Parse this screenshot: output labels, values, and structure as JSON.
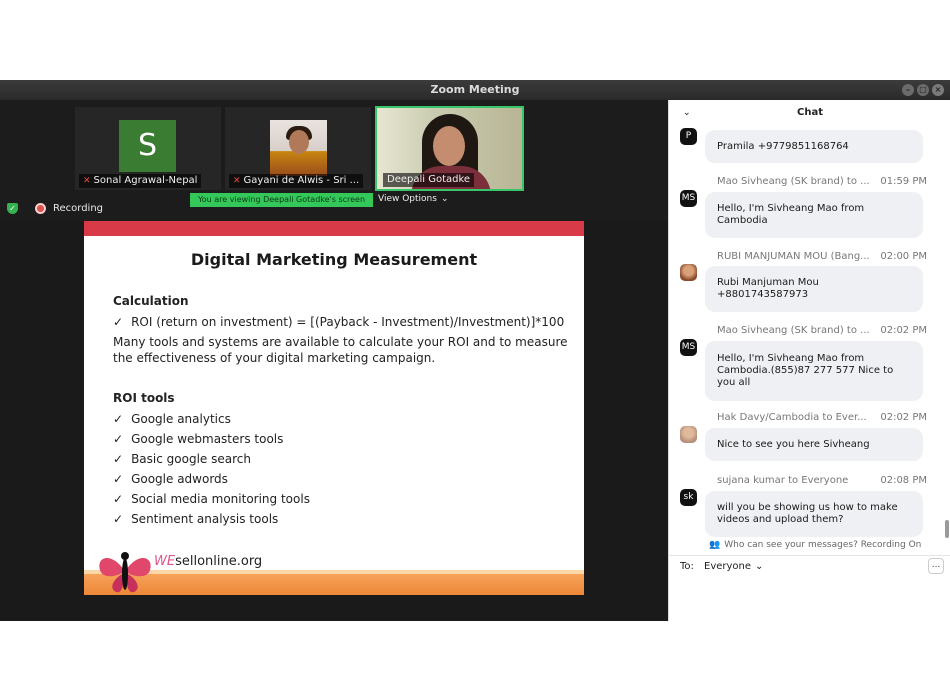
{
  "window": {
    "title": "Zoom Meeting"
  },
  "participants": [
    {
      "name": "Sonal Agrawal-Nepal",
      "initial": "S"
    },
    {
      "name": "Gayani de Alwis  - Sri ..."
    },
    {
      "name": "Deepali Gotadke"
    }
  ],
  "status": {
    "recording_label": "Recording",
    "viewing_banner": "You are viewing Deepali Gotadke's screen",
    "view_options": "View Options"
  },
  "slide": {
    "title": "Digital Marketing Measurement",
    "section1_heading": "Calculation",
    "roi_formula": "ROI (return on investment) = [(Payback - Investment)/Investment)]*100",
    "paragraph": "Many tools and systems are available to calculate your ROI and to measure the effectiveness of your digital marketing campaign.",
    "section2_heading": "ROI tools",
    "tools": [
      "Google analytics",
      "Google webmasters tools",
      "Basic google search",
      "Google adwords",
      "Social media monitoring tools",
      "Sentiment analysis tools"
    ],
    "logo_we": "WE",
    "logo_rest": "sellonline.org",
    "check_glyph": "✓"
  },
  "chat": {
    "header": "Chat",
    "messages": [
      {
        "avatar": "P",
        "sender": "",
        "time": "",
        "text": "Pramila +9779851168764"
      },
      {
        "avatar": "MS",
        "sender": "Mao Sivheang (SK brand) to ...",
        "time": "01:59 PM",
        "text": "Hello, I'm Sivheang Mao from Cambodia"
      },
      {
        "avatar": "",
        "sender": "RUBI MANJUMAN MOU (Bang...",
        "time": "02:00 PM",
        "text": "Rubi Manjuman Mou +8801743587973"
      },
      {
        "avatar": "MS",
        "sender": "Mao Sivheang (SK brand) to ...",
        "time": "02:02 PM",
        "text": "Hello, I'm Sivheang Mao from Cambodia.(855)87 277 577 Nice to you all"
      },
      {
        "avatar": "",
        "sender": "Hak Davy/Cambodia to Ever...",
        "time": "02:02 PM",
        "text": "Nice to see you here Sivheang"
      },
      {
        "avatar": "sk",
        "sender": "sujana kumar to Everyone",
        "time": "02:08 PM",
        "text": "will you be showing us how to make videos and upload them?"
      }
    ],
    "notice": "Who can see your messages? Recording On",
    "to_label": "To:",
    "to_value": "Everyone",
    "more_label": "..."
  },
  "icons": {
    "mic_muted": "mic-muted-icon",
    "shield": "shield-icon",
    "record": "record-icon",
    "chevron": "chevron-down-icon",
    "people": "people-icon"
  },
  "colors": {
    "accent_green": "#34c759",
    "slide_red": "#d83a48",
    "slide_orange": "#ed8838"
  }
}
